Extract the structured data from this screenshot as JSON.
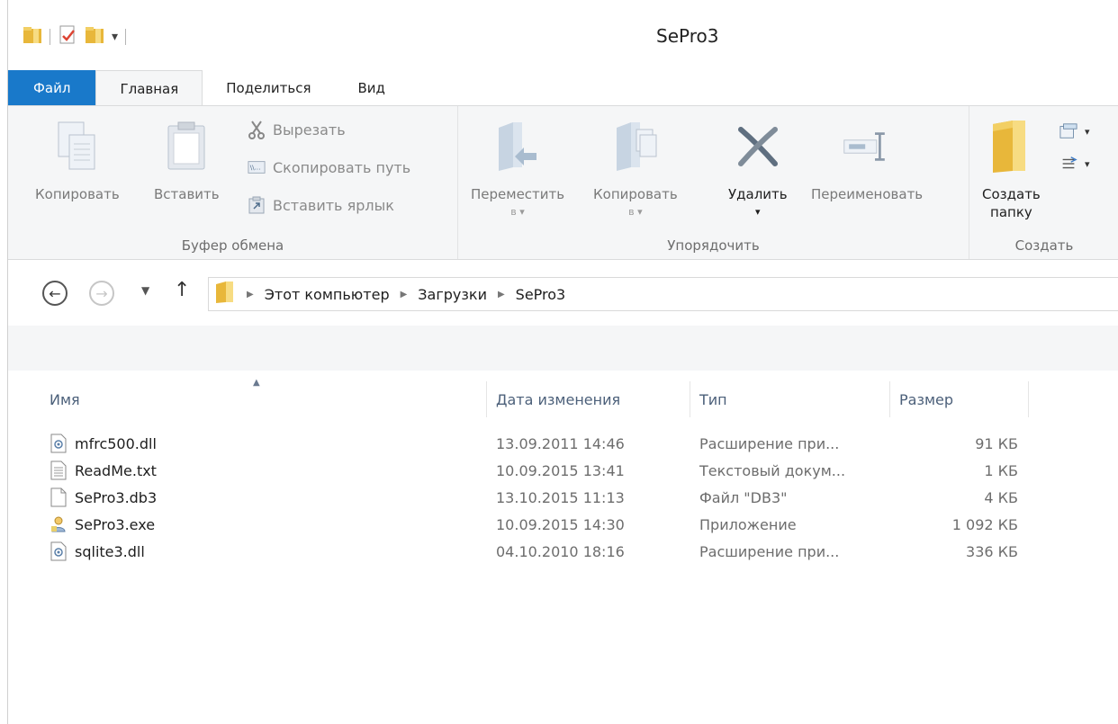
{
  "window": {
    "title": "SePro3"
  },
  "tabs": [
    {
      "label": "Файл"
    },
    {
      "label": "Главная"
    },
    {
      "label": "Поделиться"
    },
    {
      "label": "Вид"
    }
  ],
  "ribbon": {
    "clipboard": {
      "label": "Буфер обмена",
      "copy": "Копировать",
      "paste": "Вставить",
      "cut": "Вырезать",
      "copy_path": "Скопировать путь",
      "paste_shortcut": "Вставить ярлык"
    },
    "organize": {
      "label": "Упорядочить",
      "move_to": "Переместить",
      "move_to_sub": "в ▾",
      "copy_to": "Копировать",
      "copy_to_sub": "в ▾",
      "delete": "Удалить",
      "delete_sub": "▾",
      "rename": "Переименовать"
    },
    "new": {
      "label": "Создать",
      "new_folder_line1": "Создать",
      "new_folder_line2": "папку"
    }
  },
  "address": {
    "crumbs": [
      "Этот компьютер",
      "Загрузки",
      "SePro3"
    ]
  },
  "columns": {
    "name": "Имя",
    "date": "Дата изменения",
    "type": "Тип",
    "size": "Размер"
  },
  "files": [
    {
      "name": "mfrc500.dll",
      "date": "13.09.2011 14:46",
      "type": "Расширение при...",
      "size": "91 КБ",
      "icon": "dll-icon"
    },
    {
      "name": "ReadMe.txt",
      "date": "10.09.2015 13:41",
      "type": "Текстовый докум...",
      "size": "1 КБ",
      "icon": "text-file-icon"
    },
    {
      "name": "SePro3.db3",
      "date": "13.10.2015 11:13",
      "type": "Файл \"DB3\"",
      "size": "4 КБ",
      "icon": "blank-file-icon"
    },
    {
      "name": "SePro3.exe",
      "date": "10.09.2015 14:30",
      "type": "Приложение",
      "size": "1 092 КБ",
      "icon": "exe-icon"
    },
    {
      "name": "sqlite3.dll",
      "date": "04.10.2010 18:16",
      "type": "Расширение при...",
      "size": "336 КБ",
      "icon": "dll-icon"
    }
  ],
  "colors": {
    "file_tab": "#1979ca",
    "ribbon_bg": "#f5f6f7",
    "header_text": "#4c607a"
  }
}
